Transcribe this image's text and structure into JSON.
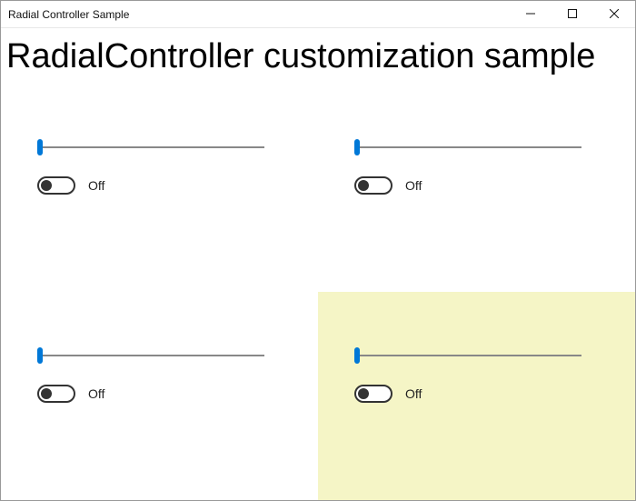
{
  "window": {
    "title": "Radial Controller Sample"
  },
  "heading": "RadialController customization sample",
  "panels": [
    {
      "toggle_label": "Off",
      "highlighted": false
    },
    {
      "toggle_label": "Off",
      "highlighted": false
    },
    {
      "toggle_label": "Off",
      "highlighted": false
    },
    {
      "toggle_label": "Off",
      "highlighted": true
    }
  ]
}
